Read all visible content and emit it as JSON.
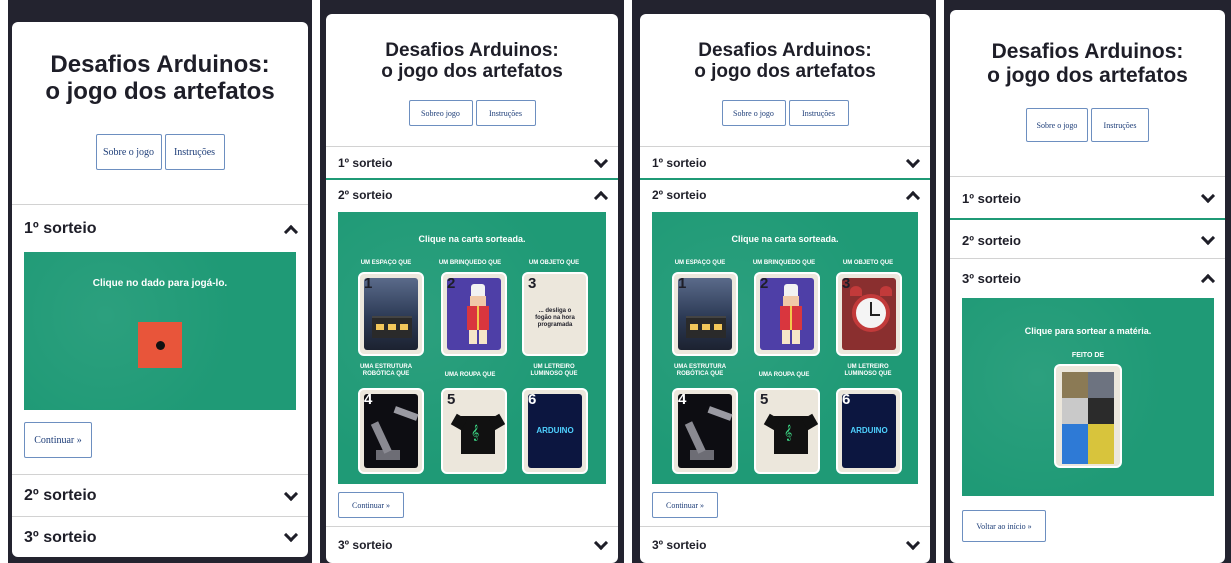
{
  "app": {
    "title_line1": "Desafios Arduinos:",
    "title_line2": "o jogo dos artefatos",
    "about_label": "Sobre o jogo",
    "about_label_alt": "Sobreo jogo",
    "instructions_label": "Instruções"
  },
  "sections": {
    "draw1": "1º sorteio",
    "draw2": "2º sorteio",
    "draw3": "3º sorteio"
  },
  "screen1": {
    "prompt": "Clique no dado para jogá-lo.",
    "continue_label": "Continuar »"
  },
  "cards_screen": {
    "prompt": "Clique na carta sorteada.",
    "categories": [
      "UM ESPAÇO QUE",
      "UM BRINQUEDO QUE",
      "UM OBJETO QUE",
      "UMA ESTRUTURA ROBÓTICA QUE",
      "UMA ROUPA QUE",
      "UM LETREIRO LUMINOSO QUE"
    ],
    "card_numbers": [
      "1",
      "2",
      "3",
      "4",
      "5",
      "6"
    ],
    "card3_text": "... desliga o fogão na hora programada",
    "arduino_text": "ARDUINO",
    "continue_label": "Continuar »"
  },
  "screen4": {
    "prompt": "Clique para sortear a matéria.",
    "label": "FEITO DE",
    "back_label": "Voltar ao início »"
  },
  "colors": {
    "green": "#1f9a76",
    "die": "#e8553a",
    "frame": "#23232f",
    "button_border": "#6d8fc0"
  }
}
